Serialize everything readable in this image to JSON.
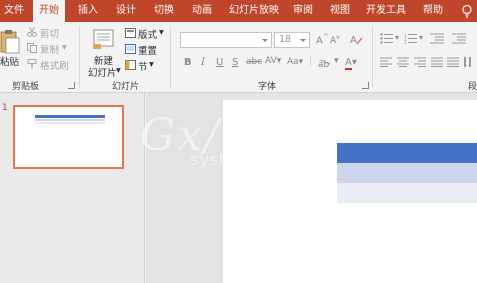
{
  "tabs": [
    {
      "label": "文件",
      "active": false
    },
    {
      "label": "开始",
      "active": true
    },
    {
      "label": "插入",
      "active": false
    },
    {
      "label": "设计",
      "active": false
    },
    {
      "label": "切换",
      "active": false
    },
    {
      "label": "动画",
      "active": false
    },
    {
      "label": "幻灯片放映",
      "active": false
    },
    {
      "label": "审阅",
      "active": false
    },
    {
      "label": "视图",
      "active": false
    },
    {
      "label": "开发工具",
      "active": false
    },
    {
      "label": "帮助",
      "active": false
    }
  ],
  "tell_me_icon": "lightbulb-icon",
  "clipboard": {
    "group_label": "剪贴板",
    "paste_label": "粘贴",
    "cut_label": "剪切",
    "copy_label": "复制",
    "format_painter_label": "格式刷"
  },
  "slides": {
    "group_label": "幻灯片",
    "new_slide_label_1": "新建",
    "new_slide_label_2": "幻灯片",
    "layout_label": "版式",
    "reset_label": "重置",
    "section_label": "节"
  },
  "font": {
    "group_label": "字体",
    "font_name_value": "",
    "font_size_value": "18",
    "bold": "B",
    "italic": "I",
    "underline": "U",
    "strikethrough": "S",
    "char_spacing": "AV",
    "change_case": "Aa",
    "grow": "A",
    "shrink": "A",
    "font_color": "A"
  },
  "paragraph": {
    "group_label": "段"
  },
  "thumbnail_pane": {
    "slide_number": "1"
  },
  "watermark": {
    "text": "Gx/",
    "sub": "system"
  },
  "colors": {
    "accent": "#c0462b",
    "table_header": "#4472c4",
    "table_band1": "#cfd5ea",
    "table_band2": "#e9ebf5",
    "thumb_border": "#e07654"
  }
}
